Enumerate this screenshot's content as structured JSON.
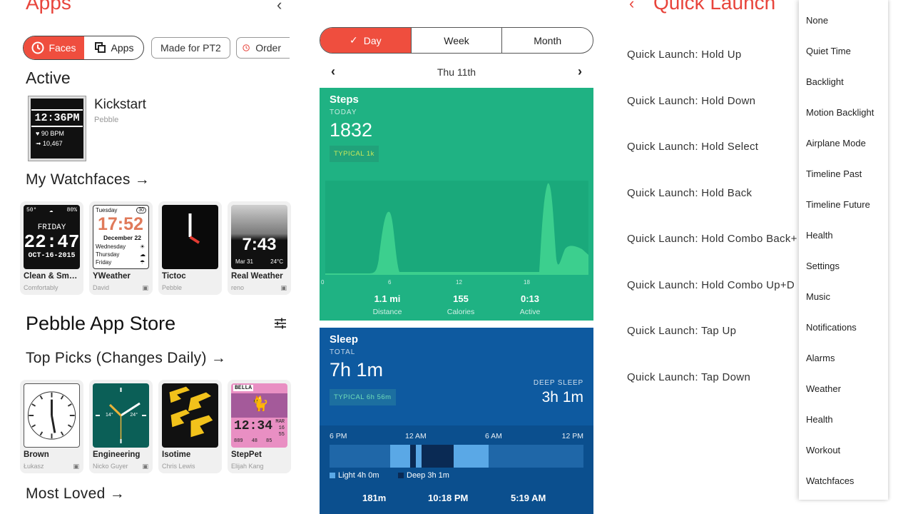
{
  "left": {
    "cut_title": "Apps",
    "filter_seg": {
      "faces": "Faces",
      "apps": "Apps"
    },
    "pills": [
      "Made for PT2",
      "Order"
    ],
    "active_heading": "Active",
    "active_face": {
      "time": "12:36PM",
      "bpm": "90 BPM",
      "steps": "10,467",
      "name": "Kickstart",
      "dev": "Pebble"
    },
    "my_watchfaces_heading": "My Watchfaces →",
    "my_watchfaces": [
      {
        "name": "Clean & Sm…",
        "dev": "Comfortably",
        "face": {
          "top_l": "50°",
          "top_r": "80%",
          "line1": "FRIDAY",
          "line2": "22:47",
          "line3": "OCT-16-2015"
        }
      },
      {
        "name": "YWeather",
        "dev": "David",
        "face": {
          "top_l": "Tuesday",
          "top_r": "30",
          "line1": "17:52",
          "line2": "December 22",
          "line3": "Wednesday Thursday Friday"
        }
      },
      {
        "name": "Tictoc",
        "dev": "Pebble"
      },
      {
        "name": "Real Weather",
        "dev": "reno",
        "face": {
          "line1": "7:43",
          "bot_l": "Mar 31",
          "bot_r": "24°C"
        }
      }
    ],
    "store_title": "Pebble App Store",
    "top_picks_heading": "Top Picks (Changes Daily) →",
    "top_picks": [
      {
        "name": "Brown",
        "dev": "Łukasz"
      },
      {
        "name": "Engineering",
        "dev": "Nicko Guyer",
        "face": {
          "l": "14°",
          "r": "24°"
        }
      },
      {
        "name": "Isotime",
        "dev": "Chris Lewis"
      },
      {
        "name": "StepPet",
        "dev": "Elijah Kang",
        "face": {
          "label": "BELLA",
          "time": "12:34",
          "side1": "MAR",
          "side2": "16",
          "side3": "55",
          "bot1": "889",
          "bot2": "48",
          "bot3": "85"
        }
      }
    ],
    "most_loved_heading": "Most Loved →"
  },
  "mid": {
    "tabs": [
      "Day",
      "Week",
      "Month"
    ],
    "date": "Thu 11th",
    "steps": {
      "title": "Steps",
      "sub": "TODAY",
      "value": "1832",
      "typical": "TYPICAL 1k",
      "ticks": [
        "0",
        "6",
        "12",
        "18"
      ],
      "stats": [
        {
          "value": "1.1 mi",
          "label": "Distance"
        },
        {
          "value": "155",
          "label": "Calories"
        },
        {
          "value": "0:13",
          "label": "Active"
        }
      ]
    },
    "sleep": {
      "title": "Sleep",
      "sub": "TOTAL",
      "value": "7h 1m",
      "typical": "TYPICAL 6h 56m",
      "deep_label": "DEEP SLEEP",
      "deep_value": "3h 1m",
      "hours": [
        "6 PM",
        "12 AM",
        "6 AM",
        "12 PM"
      ],
      "light": "Light 4h 0m",
      "deep": "Deep 3h 1m",
      "foot": [
        "181m",
        "10:18 PM",
        "5:19 AM"
      ]
    },
    "colors": {
      "steps_bg": "#1fb283",
      "sleep_bg": "#0e5aa0",
      "accent": "#ef4e3e"
    }
  },
  "right": {
    "title": "Quick Launch",
    "items": [
      "Quick Launch: Hold Up",
      "Quick Launch: Hold Down",
      "Quick Launch: Hold Select",
      "Quick Launch: Hold Back",
      "Quick Launch: Hold Combo Back+",
      "Quick Launch: Hold Combo Up+D",
      "Quick Launch: Tap Up",
      "Quick Launch: Tap Down"
    ],
    "menu": [
      "None",
      "Quiet Time",
      "Backlight",
      "Motion Backlight",
      "Airplane Mode",
      "Timeline Past",
      "Timeline Future",
      "Health",
      "Settings",
      "Music",
      "Notifications",
      "Alarms",
      "Weather",
      "Health",
      "Workout",
      "Watchfaces"
    ]
  }
}
